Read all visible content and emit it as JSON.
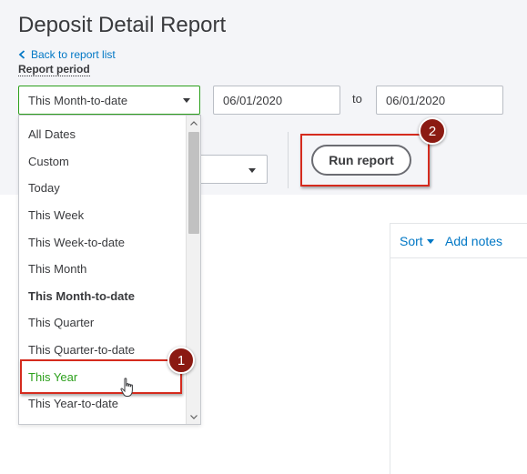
{
  "page": {
    "title": "Deposit Detail Report",
    "back_link": "Back to report list",
    "report_period_label": "Report period"
  },
  "filters": {
    "period_value": "This Month-to-date",
    "date_from": "06/01/2020",
    "to_label": "to",
    "date_to": "06/01/2020",
    "run_report_label": "Run report"
  },
  "dropdown": {
    "items": [
      {
        "label": "All Dates"
      },
      {
        "label": "Custom"
      },
      {
        "label": "Today"
      },
      {
        "label": "This Week"
      },
      {
        "label": "This Week-to-date"
      },
      {
        "label": "This Month"
      },
      {
        "label": "This Month-to-date"
      },
      {
        "label": "This Quarter"
      },
      {
        "label": "This Quarter-to-date"
      },
      {
        "label": "This Year"
      },
      {
        "label": "This Year-to-date"
      }
    ],
    "selected": "This Month-to-date",
    "hovered": "This Year"
  },
  "panel": {
    "sort_label": "Sort",
    "notes_label": "Add notes"
  },
  "annotations": {
    "badge_1": "1",
    "badge_2": "2"
  },
  "colors": {
    "accent_green": "#2ca01c",
    "link_blue": "#0077c5",
    "highlight_red": "#d52b1e",
    "badge_dark_red": "#8b1a12"
  },
  "icons": [
    "chevron-left-icon",
    "caret-down-icon",
    "scroll-up-arrow-icon",
    "scroll-down-arrow-icon",
    "hand-pointer-icon"
  ]
}
